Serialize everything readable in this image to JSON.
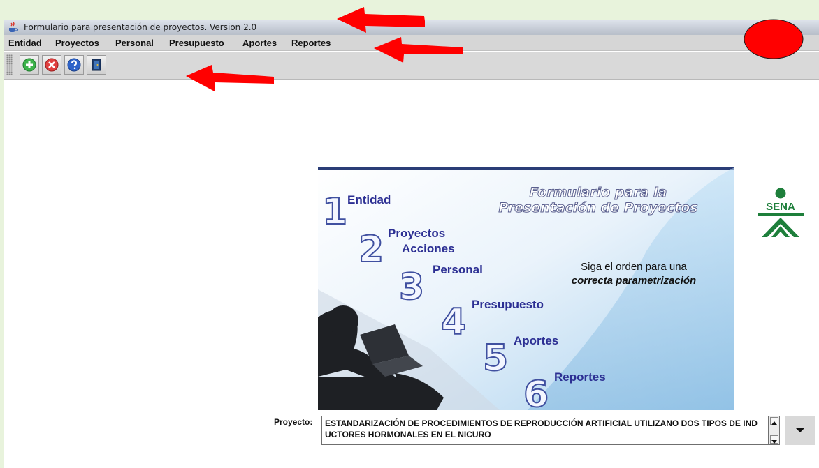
{
  "window": {
    "title": "Formulario para presentación de proyectos. Version 2.0"
  },
  "menu": [
    "Entidad",
    "Proyectos",
    "Personal",
    "Presupuesto",
    "Aportes",
    "Reportes"
  ],
  "toolbar": {
    "buttons": [
      "add-icon",
      "cancel-icon",
      "help-icon",
      "exit-icon"
    ]
  },
  "banner": {
    "title_line1": "Formulario para la",
    "title_line2": "Presentación de Proyectos",
    "hint_line1": "Siga el orden para una",
    "hint_line2": "correcta parametrización",
    "steps": [
      {
        "num": "1",
        "label": "Entidad"
      },
      {
        "num": "2",
        "label": "Proyectos",
        "label2": "Acciones"
      },
      {
        "num": "3",
        "label": "Personal"
      },
      {
        "num": "4",
        "label": "Presupuesto"
      },
      {
        "num": "5",
        "label": "Aportes"
      },
      {
        "num": "6",
        "label": "Reportes"
      }
    ]
  },
  "logo": {
    "text": "SENA"
  },
  "proyecto": {
    "label": "Proyecto:",
    "value": "ESTANDARIZACIÓN  DE PROCEDIMIENTOS DE REPRODUCCIÓN ARTIFICIAL UTILIZANO DOS TIPOS DE INDUCTORES HORMONALES EN EL NICURO"
  },
  "colors": {
    "annotation": "#ff0000",
    "accent": "#2c2f93",
    "background": "#e8f3dc"
  }
}
